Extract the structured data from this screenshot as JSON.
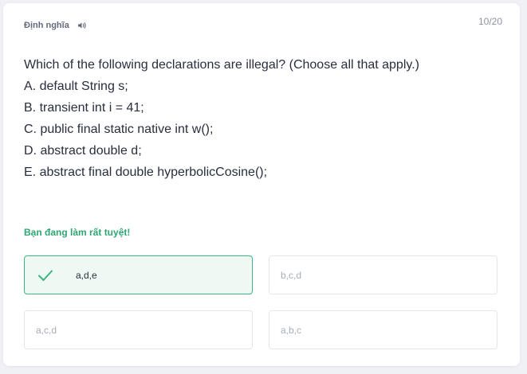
{
  "header": {
    "label": "Định nghĩa",
    "audio_icon": "speaker-icon"
  },
  "counter": "10/20",
  "question": {
    "prompt": "Which of the following declarations are illegal? (Choose all that apply.)",
    "lines": [
      "A. default String s;",
      "B. transient int i = 41;",
      "C. public final static native int w();",
      "D. abstract double d;",
      "E. abstract final double hyperbolicCosine();"
    ]
  },
  "feedback": "Bạn đang làm rất tuyệt!",
  "options": [
    {
      "label": "a,d,e",
      "state": "correct",
      "icon": "check-icon"
    },
    {
      "label": "b,c,d",
      "state": "default"
    },
    {
      "label": "a,c,d",
      "state": "default"
    },
    {
      "label": "a,b,c",
      "state": "default"
    }
  ],
  "colors": {
    "correct_border": "#3cb57f",
    "correct_bg": "#eef9f3",
    "feedback_text": "#2fa772",
    "text": "#282e3e",
    "muted": "#a6acb6"
  }
}
